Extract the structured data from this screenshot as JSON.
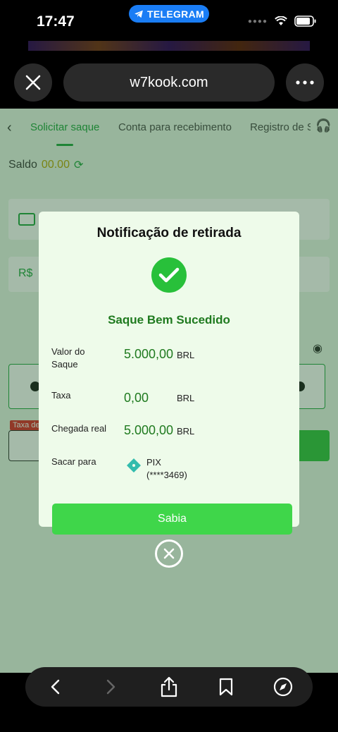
{
  "status_bar": {
    "time": "17:47",
    "pill_label": "TELEGRAM"
  },
  "browser": {
    "url": "w7kook.com"
  },
  "page": {
    "tabs": [
      {
        "label": "Solicitar saque",
        "active": true
      },
      {
        "label": "Conta para recebimento",
        "active": false
      },
      {
        "label": "Registro de S",
        "active": false
      }
    ],
    "saldo_label": "Saldo",
    "saldo_value": "00.00",
    "currency_symbol": "R$",
    "taxa_tag": "Taxa de"
  },
  "modal": {
    "title": "Notificação de retirada",
    "success": "Saque Bem Sucedido",
    "rows": [
      {
        "label": "Valor do Saque",
        "value": "5.000,00",
        "unit": "BRL"
      },
      {
        "label": "Taxa",
        "value": "0,00",
        "unit": "BRL"
      },
      {
        "label": "Chegada real",
        "value": "5.000,00",
        "unit": "BRL"
      }
    ],
    "sacar_label": "Sacar para",
    "pix_name": "PIX",
    "pix_account": "(****3469)",
    "confirm_button": "Sabia"
  },
  "colors": {
    "accent": "#19a33a",
    "success_text": "#1f7a1f",
    "button": "#3fd64a",
    "telegram": "#1a7df5"
  },
  "icons": [
    "telegram-icon",
    "wifi-icon",
    "battery-icon",
    "close-icon",
    "more-icon",
    "back-icon",
    "headset-icon",
    "refresh-icon",
    "wallet-icon",
    "eye-off-icon",
    "check-icon",
    "pix-icon",
    "close-circle-icon",
    "share-icon",
    "bookmark-icon",
    "compass-icon"
  ]
}
